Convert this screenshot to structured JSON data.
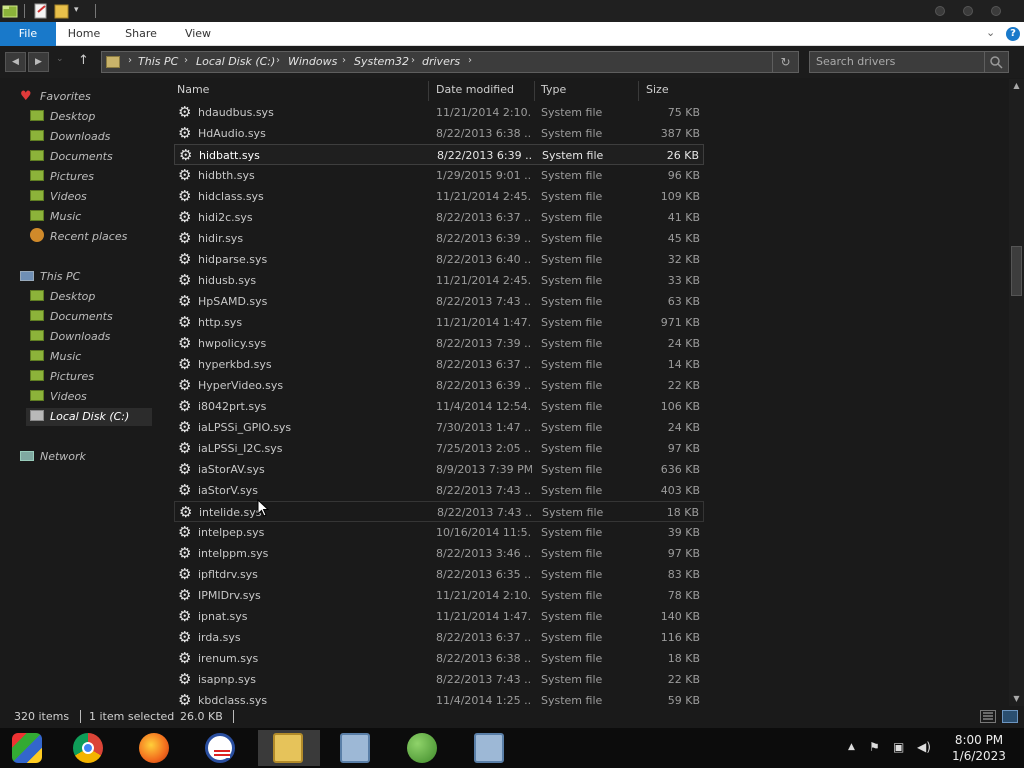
{
  "ribbon": {
    "tabs": [
      "File",
      "Home",
      "Share",
      "View"
    ]
  },
  "address": {
    "crumbs": [
      "This PC",
      "Local Disk (C:)",
      "Windows",
      "System32",
      "drivers"
    ],
    "search_placeholder": "Search drivers"
  },
  "nav": {
    "favorites_label": "Favorites",
    "favorites": [
      "Desktop",
      "Downloads",
      "Documents",
      "Pictures",
      "Videos",
      "Music",
      "Recent places"
    ],
    "thispc_label": "This PC",
    "thispc": [
      "Desktop",
      "Documents",
      "Downloads",
      "Music",
      "Pictures",
      "Videos",
      "Local Disk (C:)"
    ],
    "network_label": "Network"
  },
  "columns": {
    "name": "Name",
    "date": "Date modified",
    "type": "Type",
    "size": "Size"
  },
  "files": [
    {
      "name": "hdaudbus.sys",
      "date": "11/21/2014 2:10...",
      "type": "System file",
      "size": "75 KB"
    },
    {
      "name": "HdAudio.sys",
      "date": "8/22/2013 6:38 ...",
      "type": "System file",
      "size": "387 KB"
    },
    {
      "name": "hidbatt.sys",
      "date": "8/22/2013 6:39 ...",
      "type": "System file",
      "size": "26 KB"
    },
    {
      "name": "hidbth.sys",
      "date": "1/29/2015 9:01 ...",
      "type": "System file",
      "size": "96 KB"
    },
    {
      "name": "hidclass.sys",
      "date": "11/21/2014 2:45...",
      "type": "System file",
      "size": "109 KB"
    },
    {
      "name": "hidi2c.sys",
      "date": "8/22/2013 6:37 ...",
      "type": "System file",
      "size": "41 KB"
    },
    {
      "name": "hidir.sys",
      "date": "8/22/2013 6:39 ...",
      "type": "System file",
      "size": "45 KB"
    },
    {
      "name": "hidparse.sys",
      "date": "8/22/2013 6:40 ...",
      "type": "System file",
      "size": "32 KB"
    },
    {
      "name": "hidusb.sys",
      "date": "11/21/2014 2:45...",
      "type": "System file",
      "size": "33 KB"
    },
    {
      "name": "HpSAMD.sys",
      "date": "8/22/2013 7:43 ...",
      "type": "System file",
      "size": "63 KB"
    },
    {
      "name": "http.sys",
      "date": "11/21/2014 1:47...",
      "type": "System file",
      "size": "971 KB"
    },
    {
      "name": "hwpolicy.sys",
      "date": "8/22/2013 7:39 ...",
      "type": "System file",
      "size": "24 KB"
    },
    {
      "name": "hyperkbd.sys",
      "date": "8/22/2013 6:37 ...",
      "type": "System file",
      "size": "14 KB"
    },
    {
      "name": "HyperVideo.sys",
      "date": "8/22/2013 6:39 ...",
      "type": "System file",
      "size": "22 KB"
    },
    {
      "name": "i8042prt.sys",
      "date": "11/4/2014 12:54...",
      "type": "System file",
      "size": "106 KB"
    },
    {
      "name": "iaLPSSi_GPIO.sys",
      "date": "7/30/2013 1:47 ...",
      "type": "System file",
      "size": "24 KB"
    },
    {
      "name": "iaLPSSi_I2C.sys",
      "date": "7/25/2013 2:05 ...",
      "type": "System file",
      "size": "97 KB"
    },
    {
      "name": "iaStorAV.sys",
      "date": "8/9/2013 7:39 PM",
      "type": "System file",
      "size": "636 KB"
    },
    {
      "name": "iaStorV.sys",
      "date": "8/22/2013 7:43 ...",
      "type": "System file",
      "size": "403 KB"
    },
    {
      "name": "intelide.sys",
      "date": "8/22/2013 7:43 ...",
      "type": "System file",
      "size": "18 KB"
    },
    {
      "name": "intelpep.sys",
      "date": "10/16/2014 11:5...",
      "type": "System file",
      "size": "39 KB"
    },
    {
      "name": "intelppm.sys",
      "date": "8/22/2013 3:46 ...",
      "type": "System file",
      "size": "97 KB"
    },
    {
      "name": "ipfltdrv.sys",
      "date": "8/22/2013 6:35 ...",
      "type": "System file",
      "size": "83 KB"
    },
    {
      "name": "IPMIDrv.sys",
      "date": "11/21/2014 2:10...",
      "type": "System file",
      "size": "78 KB"
    },
    {
      "name": "ipnat.sys",
      "date": "11/21/2014 1:47...",
      "type": "System file",
      "size": "140 KB"
    },
    {
      "name": "irda.sys",
      "date": "8/22/2013 6:37 ...",
      "type": "System file",
      "size": "116 KB"
    },
    {
      "name": "irenum.sys",
      "date": "8/22/2013 6:38 ...",
      "type": "System file",
      "size": "18 KB"
    },
    {
      "name": "isapnp.sys",
      "date": "8/22/2013 7:43 ...",
      "type": "System file",
      "size": "22 KB"
    },
    {
      "name": "kbdclass.sys",
      "date": "11/4/2014 1:25 ...",
      "type": "System file",
      "size": "59 KB"
    }
  ],
  "selected_index": 2,
  "hover_index": 19,
  "status": {
    "items": "320 items",
    "selected": "1 item selected",
    "size": "26.0 KB"
  },
  "clock": {
    "time": "8:00 PM",
    "date": "1/6/2023"
  },
  "taskbar_apps": [
    "windows-start-icon",
    "chrome-icon",
    "firefox-icon",
    "obama-logo-icon",
    "file-explorer-icon",
    "setup-installer-icon",
    "users-network-icon",
    "setup-installer-2-icon"
  ],
  "colors": {
    "accent": "#1979ca",
    "background": "#1a1a1a"
  }
}
